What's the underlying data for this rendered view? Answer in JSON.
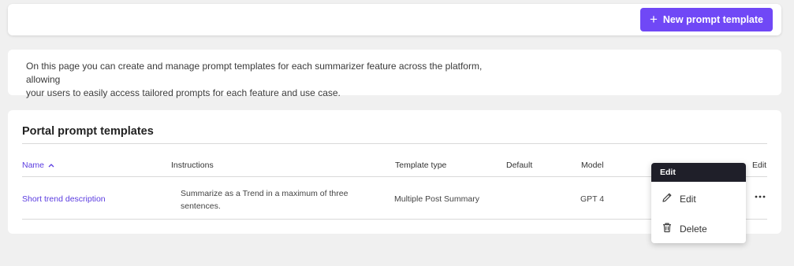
{
  "toolbar": {
    "new_button_icon": "plus-icon",
    "new_button_label": "New prompt template",
    "accent_color": "#7048f6"
  },
  "intro": {
    "text_line1": "On this page you can create and manage prompt templates for each summarizer feature across the platform, allowing",
    "text_line2": "your users to easily access tailored prompts for each feature and use case."
  },
  "section": {
    "title": "Portal prompt templates"
  },
  "table": {
    "columns": {
      "name": "Name",
      "name_sort_icon": "chevron-up-icon",
      "instructions": "Instructions",
      "template_type": "Template type",
      "default": "Default",
      "model": "Model",
      "edit": "Edit"
    },
    "rows": [
      {
        "name": "Short trend description",
        "instructions_line1": "Summarize as a Trend in a maximum of three",
        "instructions_line2": "sentences.",
        "template_type": "Multiple Post Summary",
        "default": "",
        "model": "GPT 4",
        "actions_icon": "more-horizontal-icon"
      }
    ]
  },
  "context_menu": {
    "header": "Edit",
    "items": [
      {
        "label": "Edit",
        "icon": "pencil-icon"
      },
      {
        "label": "Delete",
        "icon": "trash-icon"
      }
    ]
  }
}
